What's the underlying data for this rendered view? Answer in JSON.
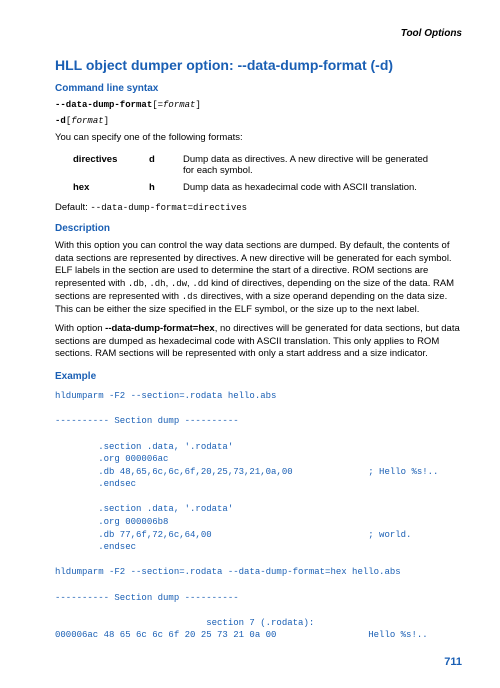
{
  "header": {
    "section": "Tool Options"
  },
  "title": "HLL object dumper option: --data-dump-format (-d)",
  "syntax": {
    "heading": "Command line syntax",
    "line1_a": "--data-dump-format",
    "line1_b": "[=",
    "line1_c": "format",
    "line1_d": "]",
    "line2_a": "-d",
    "line2_b": "[",
    "line2_c": "format",
    "line2_d": "]",
    "intro": "You can specify one of the following formats:"
  },
  "formats": [
    {
      "key": "directives",
      "short": "d",
      "desc": "Dump data as directives. A new directive will be generated for each symbol."
    },
    {
      "key": "hex",
      "short": "h",
      "desc": "Dump data as hexadecimal code with ASCII translation."
    }
  ],
  "default": {
    "label": "Default: ",
    "value": "--data-dump-format=directives"
  },
  "description": {
    "heading": "Description",
    "p1a": "With this option you can control the way data sections are dumped. By default, the contents of data sections are represented by directives. A new directive will be generated for each symbol. ELF labels in the section are used to determine the start of a directive. ROM sections are represented with ",
    "p1b": ".db",
    "p1c": ", ",
    "p1d": ".dh",
    "p1e": ", ",
    "p1f": ".dw",
    "p1g": ", ",
    "p1h": ".dd",
    "p1i": " kind of directives, depending on the size of the data. RAM sections are represented with ",
    "p1j": ".ds",
    "p1k": " directives, with a size operand depending on the data size. This can be either the size specified in the ELF symbol, or the size up to the next label.",
    "p2a": "With option ",
    "p2b": "--data-dump-format=hex",
    "p2c": ", no directives will be generated for data sections, but data sections are dumped as hexadecimal code with ASCII translation. This only applies to ROM sections. RAM sections will be represented with only a start address and a size indicator."
  },
  "example": {
    "heading": "Example",
    "code": "hldumparm -F2 --section=.rodata hello.abs\n\n---------- Section dump ----------\n\n        .section .data, '.rodata'\n        .org 000006ac\n        .db 48,65,6c,6c,6f,20,25,73,21,0a,00              ; Hello %s!..\n        .endsec\n\n        .section .data, '.rodata'\n        .org 000006b8\n        .db 77,6f,72,6c,64,00                             ; world.\n        .endsec\n\nhldumparm -F2 --section=.rodata --data-dump-format=hex hello.abs\n\n---------- Section dump ----------\n\n                            section 7 (.rodata):\n000006ac 48 65 6c 6c 6f 20 25 73 21 0a 00                 Hello %s!.."
  },
  "page_number": "711"
}
